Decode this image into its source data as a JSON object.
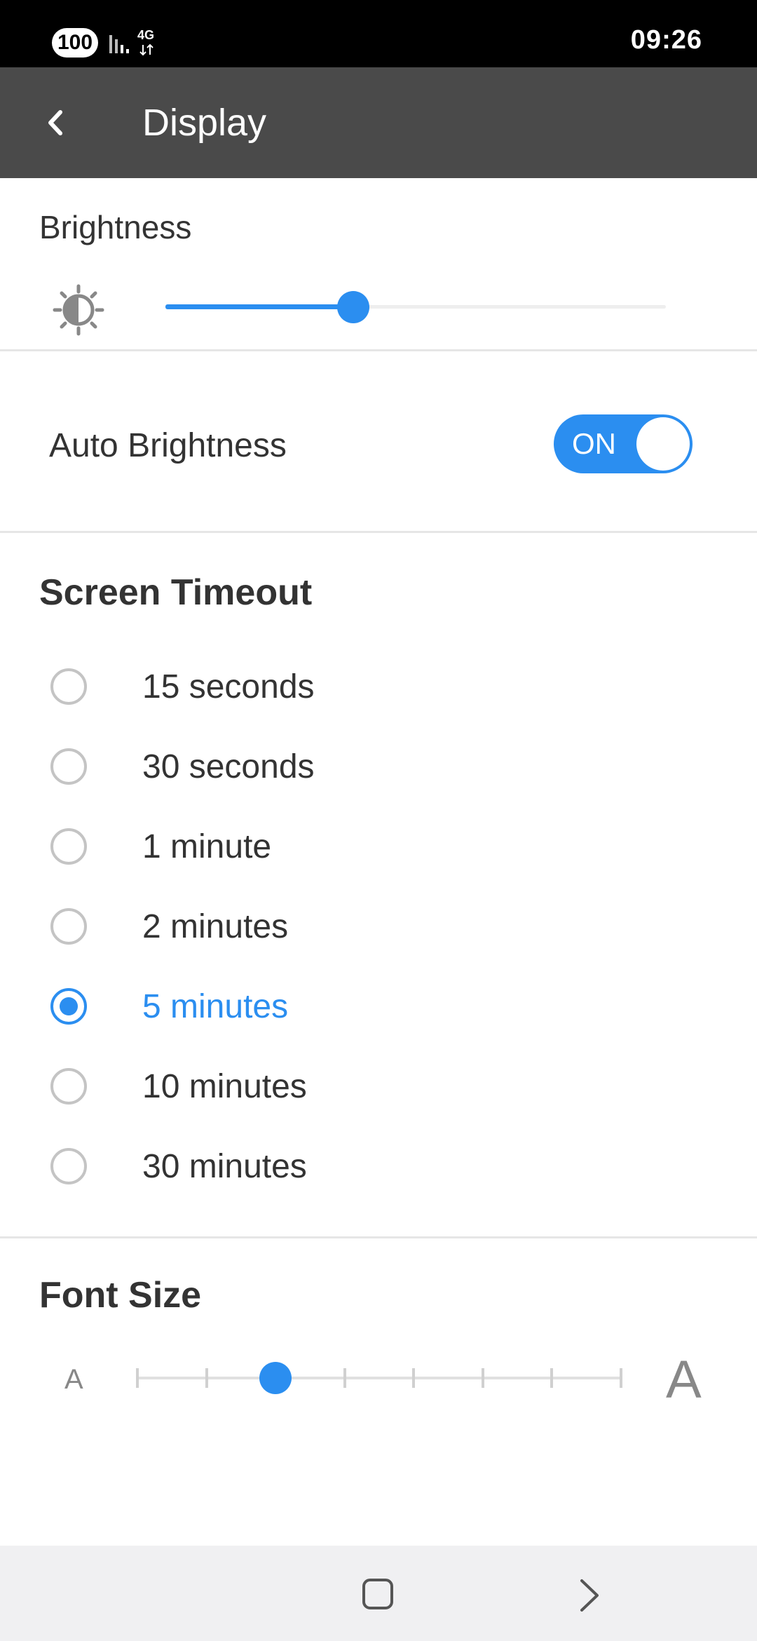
{
  "status_bar": {
    "battery": "100",
    "network": "4G",
    "time": "09:26"
  },
  "app_bar": {
    "title": "Display",
    "back_icon": "chevron-left-icon"
  },
  "brightness": {
    "label": "Brightness",
    "icon": "brightness-icon",
    "level": 0.375,
    "accent_color": "#2b8ef0"
  },
  "auto_brightness": {
    "label": "Auto Brightness",
    "toggle_text": "ON",
    "enabled": true
  },
  "screen_timeout": {
    "title": "Screen Timeout",
    "options": [
      {
        "label": "15 seconds",
        "selected": false
      },
      {
        "label": "30 seconds",
        "selected": false
      },
      {
        "label": "1 minute",
        "selected": false
      },
      {
        "label": "2 minutes",
        "selected": false
      },
      {
        "label": "5 minutes",
        "selected": true
      },
      {
        "label": "10 minutes",
        "selected": false
      },
      {
        "label": "30 minutes",
        "selected": false
      }
    ]
  },
  "font_size": {
    "title": "Font Size",
    "small_label": "A",
    "large_label": "A",
    "steps": 8,
    "selected_step": 3
  },
  "nav_bar": {
    "home_icon": "square-home-icon",
    "back_icon": "chevron-right-icon"
  }
}
